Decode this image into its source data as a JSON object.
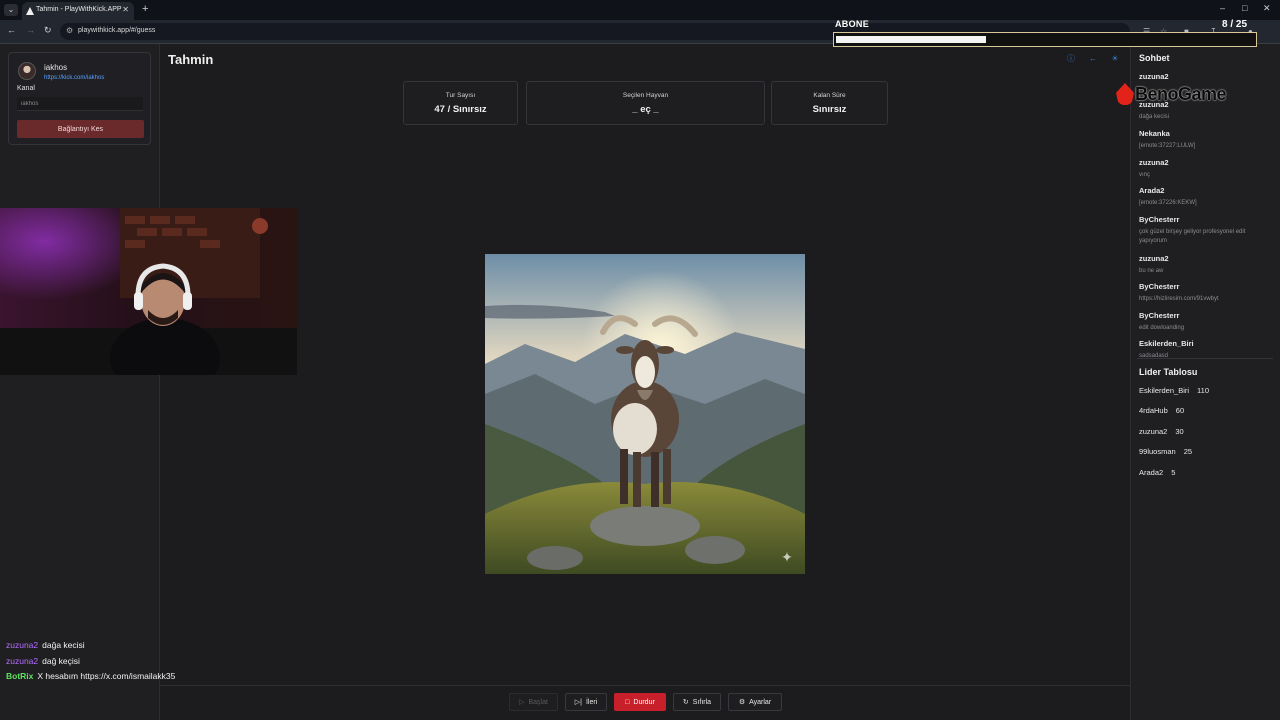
{
  "browser": {
    "tab_title": "Tahmin - PlayWithKick.APP",
    "url": "playwithkick.app/#/guess"
  },
  "stream_overlay": {
    "subscribe_label": "ABONE",
    "subscribe_count": "8 / 25",
    "subscribe_progress": 0.36,
    "logo_text": "BenoGame"
  },
  "channel": {
    "name": "iakhos",
    "link": "https://kick.com/iakhos",
    "label": "Kanal",
    "input_value": "iakhos",
    "disconnect_label": "Bağlantıyı Kes"
  },
  "overlay_chat": [
    {
      "user": "zuzuna2",
      "text": "dağa kecisi",
      "color": "#b46cff"
    },
    {
      "user": "zuzuna2",
      "text": "dağ keçisi",
      "color": "#b46cff"
    },
    {
      "user": "BotRix",
      "text": "X hesabım https://x.com/ismailakk35",
      "color": "#5fe35f"
    }
  ],
  "main": {
    "title": "Tahmin",
    "header_icons": [
      "info-icon",
      "arrow-left-icon",
      "sun-icon"
    ],
    "stats": [
      {
        "label": "Tur Sayısı",
        "value": "47 / Sınırsız"
      },
      {
        "label": "Seçilen Hayvan",
        "value": "_ eç _"
      },
      {
        "label": "Kalan Süre",
        "value": "Sınırsız"
      }
    ]
  },
  "controls": {
    "start": "Başlat",
    "next": "İleri",
    "stop": "Durdur",
    "reset": "Sıfırla",
    "settings": "Ayarlar",
    "accent_danger": "#c8202a"
  },
  "chat": {
    "title": "Sohbet",
    "messages": [
      {
        "user": "zuzuna2",
        "text": ""
      },
      {
        "user": "zuzuna2",
        "text": "dağa kecisi"
      },
      {
        "user": "Nekanka",
        "text": "[emote:37227:LULW]"
      },
      {
        "user": "zuzuna2",
        "text": "vınç"
      },
      {
        "user": "Arada2",
        "text": "[emote:37226:KEKW]"
      },
      {
        "user": "ByChesterr",
        "text": "çok güzel birşey geliyor profesyonel edit yapıyorum"
      },
      {
        "user": "zuzuna2",
        "text": "bu ne aw"
      },
      {
        "user": "ByChesterr",
        "text": "https://hizliresim.com/91vwbyt"
      },
      {
        "user": "ByChesterr",
        "text": "edit dowloanding"
      },
      {
        "user": "Eskilerden_Biri",
        "text": "sadsadasd"
      }
    ]
  },
  "leaderboard": {
    "title": "Lider Tablosu",
    "rows": [
      {
        "name": "Eskilerden_Biri",
        "score": "110"
      },
      {
        "name": "4rdaHub",
        "score": "60"
      },
      {
        "name": "zuzuna2",
        "score": "30"
      },
      {
        "name": "99luosman",
        "score": "25"
      },
      {
        "name": "Arada2",
        "score": "5"
      }
    ]
  }
}
